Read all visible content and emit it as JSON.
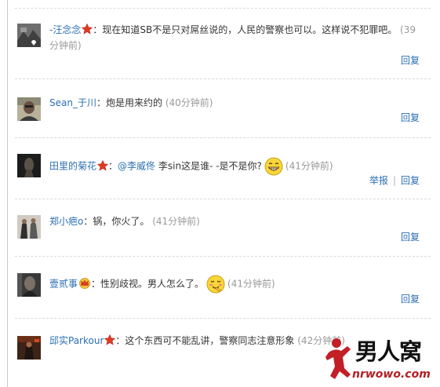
{
  "colors": {
    "link": "#2b6fb3",
    "text": "#333333",
    "time": "#999999",
    "badge_red": "#e03b21",
    "watermark_red": "#b21e25"
  },
  "comments": [
    {
      "user": "-汪念念",
      "badge": "star-badge-icon",
      "text": "现在知道SB不是只对屌丝说的，人民的警察也可以。这样说不犯罪吧。",
      "time": "(39分钟前)",
      "reply": "回复"
    },
    {
      "user": "Sean_于川",
      "text": "炮是用来约的",
      "time": "(40分钟前)",
      "reply": "回复"
    },
    {
      "user": "田里的菊花",
      "badge": "star-badge-icon",
      "mention": "@李威佟",
      "text": "李sin这是谁- -是不是你?",
      "emoticon": "grin-emoticon-icon",
      "time": "(41分钟前)",
      "report": "举报",
      "reply": "回复"
    },
    {
      "user": "郑小疤o",
      "text": "锅，你火了。",
      "time": "(41分钟前)",
      "reply": "回复"
    },
    {
      "user": "壹贰事",
      "badge": "crown-badge-icon",
      "text": "性别歧视。男人怎么了。",
      "emoticon": "snicker-emoticon-icon",
      "time": "(41分钟前)",
      "reply": "回复"
    },
    {
      "user": "邱实Parkour",
      "badge": "star-badge-icon",
      "text": "这个东西可不能乱讲，警察同志注意形象",
      "time": "(42分钟前)"
    }
  ],
  "watermark": {
    "title": "男人窝",
    "url": "nrwowo.com"
  }
}
